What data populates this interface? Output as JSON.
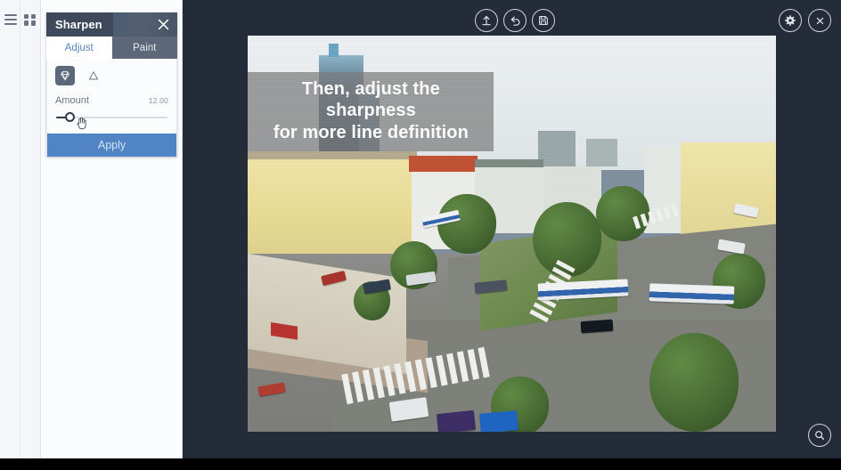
{
  "app": {
    "background_color": "#1d2430",
    "canvas_color": "#252c39"
  },
  "left_rail": {
    "menu_icon": "hamburger-menu-icon",
    "grid_icon": "grid-view-icon"
  },
  "panel": {
    "title": "Sharpen",
    "close_icon": "close-icon",
    "accent_color": "#5184c4",
    "titlebar_color": "#3e4a5c",
    "tabs": [
      {
        "label": "Adjust",
        "active": true
      },
      {
        "label": "Paint",
        "active": false
      }
    ],
    "modes": [
      {
        "icon": "diamond-icon",
        "selected": true
      },
      {
        "icon": "triangle-icon",
        "selected": false
      }
    ],
    "slider": {
      "label": "Amount",
      "value": "12.00",
      "percent": 12,
      "cursor_icon": "hand-pointer-icon"
    },
    "apply_label": "Apply"
  },
  "toolbar": {
    "center_buttons": [
      {
        "icon": "upload-icon",
        "name": "upload-button"
      },
      {
        "icon": "undo-icon",
        "name": "undo-button"
      },
      {
        "icon": "save-icon",
        "name": "save-button"
      }
    ],
    "right_buttons": [
      {
        "icon": "gear-icon",
        "name": "settings-button"
      },
      {
        "icon": "close-icon",
        "name": "close-editor-button"
      }
    ],
    "zoom_button": {
      "icon": "magnifier-icon",
      "name": "zoom-button"
    }
  },
  "image": {
    "caption_line_1": "Then, adjust the sharpness",
    "caption_line_2": "for more line definition",
    "caption_background": "rgba(125,125,125,.72)",
    "description": "aerial photo of a city intersection with yellow apartment buildings, a glass tower, trees, crosswalks, cars and blue-white trolleybuses"
  }
}
